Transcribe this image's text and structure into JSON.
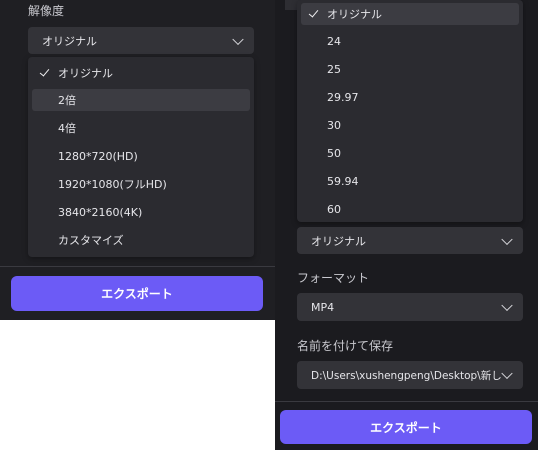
{
  "left": {
    "resolution_label": "解像度",
    "resolution_select_value": "オリジナル",
    "resolution_options": [
      "オリジナル",
      "2倍",
      "4倍",
      "1280*720(HD)",
      "1920*1080(フルHD)",
      "3840*2160(4K)",
      "カスタマイズ"
    ],
    "selected_option": "オリジナル",
    "hovered_option": "2倍",
    "export_button": "エクスポート"
  },
  "right": {
    "framerate_options": [
      "オリジナル",
      "24",
      "25",
      "29.97",
      "30",
      "50",
      "59.94",
      "60"
    ],
    "selected_option": "オリジナル",
    "framerate_select_value": "オリジナル",
    "format_label": "フォーマット",
    "format_value": "MP4",
    "save_as_label": "名前を付けて保存",
    "save_path": "D:\\Users\\xushengpeng\\Desktop\\新し...",
    "export_button": "エクスポート"
  },
  "colors": {
    "accent": "#6c5bf6",
    "panel_bg": "#1f1f23",
    "menu_bg": "#2b2b30",
    "select_bg": "#333338",
    "highlight_bg": "#3c3c42"
  }
}
